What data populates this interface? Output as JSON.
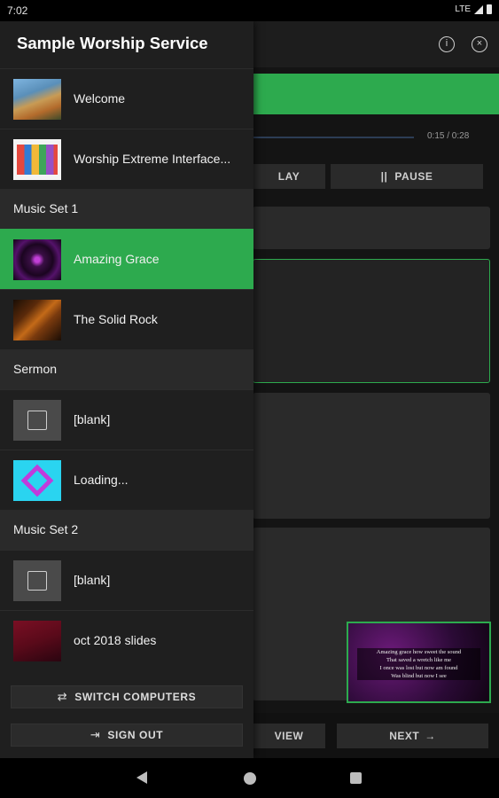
{
  "status_bar": {
    "time": "7:02",
    "network": "LTE"
  },
  "background": {
    "progress_time": "0:15 / 0:28",
    "play_label_partial": "LAY",
    "pause_label": "PAUSE",
    "pause_icon": "||",
    "preview_label_partial": "VIEW",
    "next_label": "NEXT",
    "next_icon": "→",
    "preview_slide_lines": [
      "Amazing grace how sweet the sound",
      "That saved a wretch like me",
      "I once was lost but now am found",
      "Was blind but now I see"
    ],
    "info_icon": "i",
    "close_icon": "×"
  },
  "drawer": {
    "title": "Sample Worship Service",
    "items_top": [
      {
        "label": "Welcome",
        "thumb": "ocean"
      },
      {
        "label": "Worship Extreme Interface...",
        "thumb": "screen"
      }
    ],
    "section_1": "Music Set 1",
    "items_music1": [
      {
        "label": "Amazing Grace",
        "thumb": "purple",
        "selected": true
      },
      {
        "label": "The Solid Rock",
        "thumb": "rock"
      }
    ],
    "section_2": "Sermon",
    "items_sermon": [
      {
        "label": "[blank]",
        "thumb": "blank"
      },
      {
        "label": "Loading...",
        "thumb": "kaleido"
      }
    ],
    "section_3": "Music Set 2",
    "items_music2": [
      {
        "label": "[blank]",
        "thumb": "blank"
      },
      {
        "label": "oct 2018 slides",
        "thumb": "crimson"
      }
    ],
    "switch_label": "SWITCH COMPUTERS",
    "switch_icon": "⇄",
    "signout_label": "SIGN OUT",
    "signout_icon": "⇥"
  },
  "colors": {
    "accent": "#2daa4e",
    "drawer_bg": "#1f1f1f",
    "section_bg": "#2a2a2a"
  }
}
